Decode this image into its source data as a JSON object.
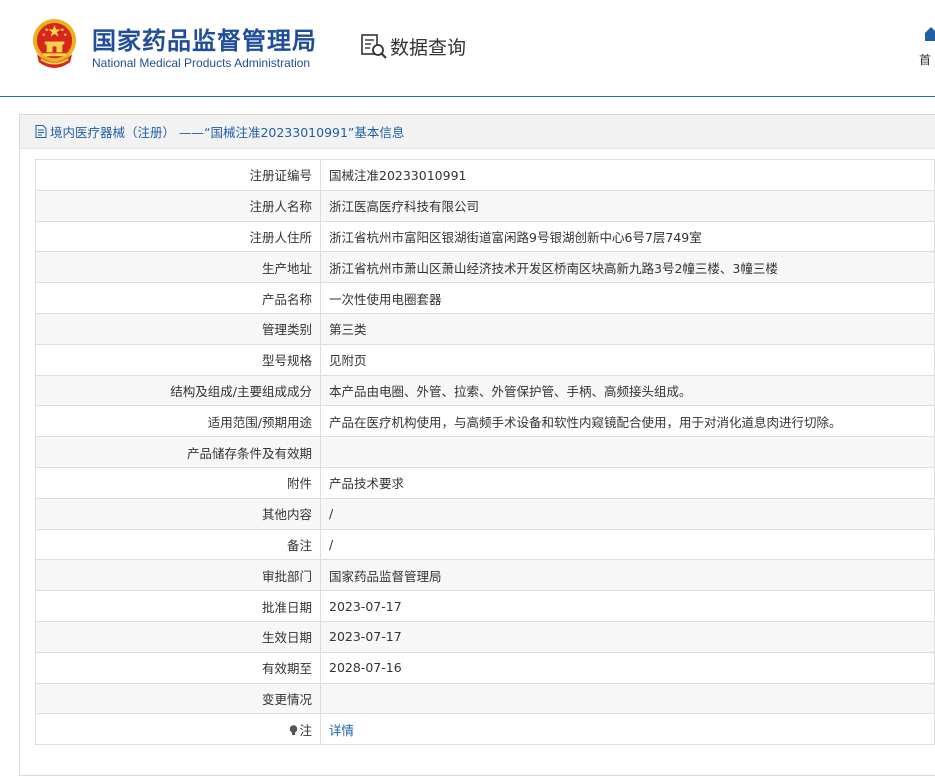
{
  "header": {
    "title_cn": "国家药品监督管理局",
    "title_en": "National Medical Products Administration",
    "query_label": "数据查询",
    "home_label": "首"
  },
  "panel": {
    "title": "境内医疗器械（注册） ——“国械注准20233010991”基本信息"
  },
  "rows": [
    {
      "label": "注册证编号",
      "value": "国械注准20233010991"
    },
    {
      "label": "注册人名称",
      "value": "浙江医高医疗科技有限公司"
    },
    {
      "label": "注册人住所",
      "value": "浙江省杭州市富阳区银湖街道富闲路9号银湖创新中心6号7层749室"
    },
    {
      "label": "生产地址",
      "value": "浙江省杭州市萧山区萧山经济技术开发区桥南区块高新九路3号2幢三楼、3幢三楼"
    },
    {
      "label": "产品名称",
      "value": "一次性使用电圈套器"
    },
    {
      "label": "管理类别",
      "value": "第三类"
    },
    {
      "label": "型号规格",
      "value": "见附页"
    },
    {
      "label": "结构及组成/主要组成成分",
      "value": "本产品由电圈、外管、拉索、外管保护管、手柄、高频接头组成。"
    },
    {
      "label": "适用范围/预期用途",
      "value": "产品在医疗机构使用，与高频手术设备和软性内窥镜配合使用，用于对消化道息肉进行切除。"
    },
    {
      "label": "产品储存条件及有效期",
      "value": ""
    },
    {
      "label": "附件",
      "value": "产品技术要求"
    },
    {
      "label": "其他内容",
      "value": "/"
    },
    {
      "label": "备注",
      "value": "/"
    },
    {
      "label": "审批部门",
      "value": "国家药品监督管理局"
    },
    {
      "label": "批准日期",
      "value": "2023-07-17"
    },
    {
      "label": "生效日期",
      "value": "2023-07-17"
    },
    {
      "label": "有效期至",
      "value": "2028-07-16"
    },
    {
      "label": "变更情况",
      "value": ""
    }
  ],
  "note_row": {
    "label": "注",
    "link": "详情"
  },
  "colors": {
    "brand_blue": "#1f4d9b",
    "link_blue": "#1f5fa8",
    "header_bg": "#f2f2f2"
  },
  "icons": {
    "emblem": "national-emblem-icon",
    "query": "magnifier-document-icon",
    "home": "home-icon",
    "doc": "document-icon",
    "bulb": "lightbulb-icon"
  }
}
